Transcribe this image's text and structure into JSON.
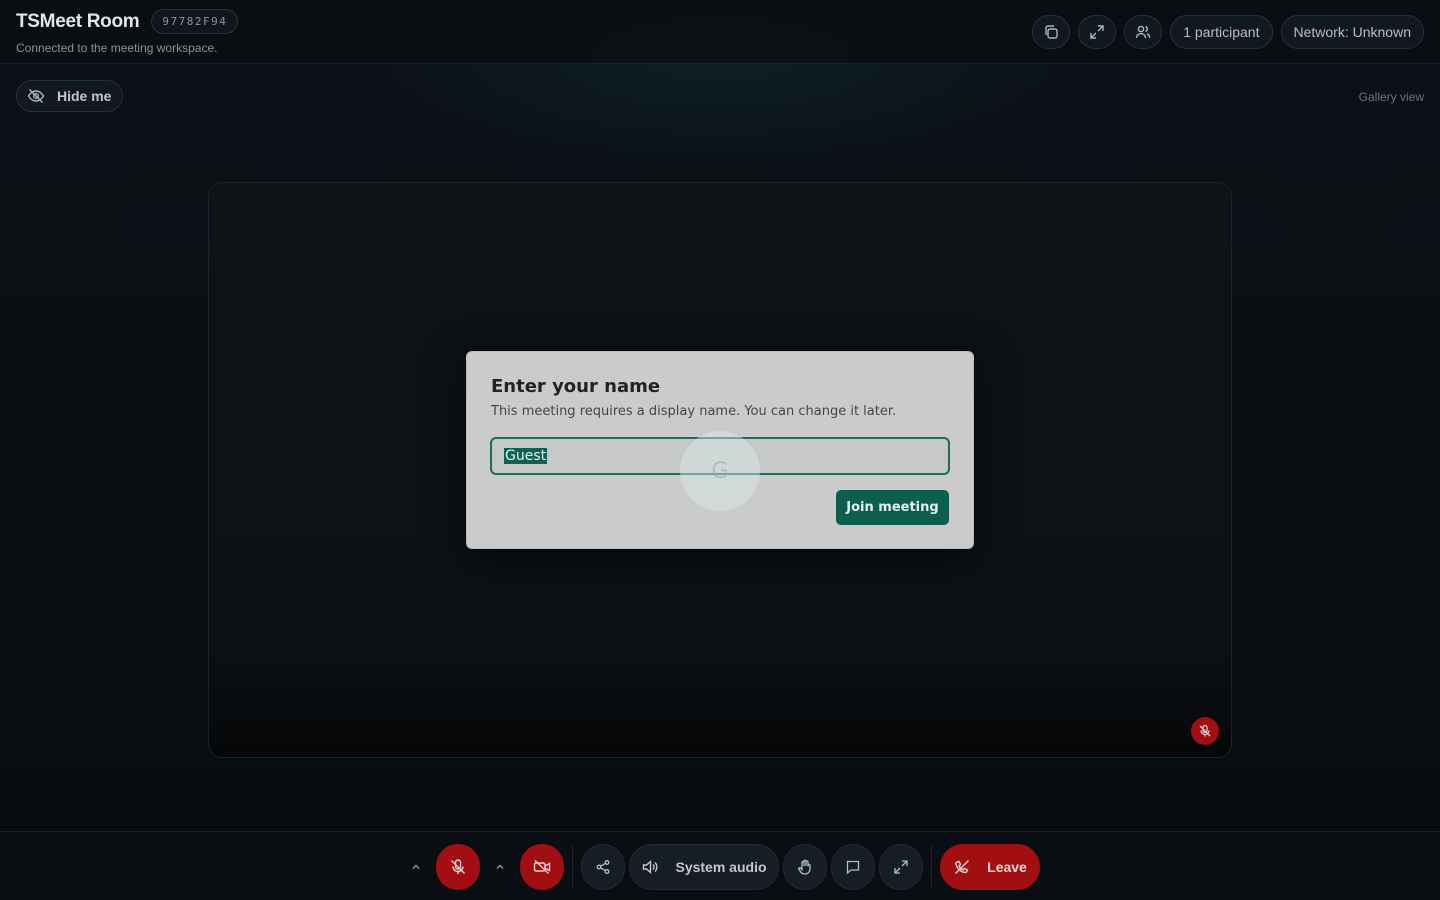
{
  "header": {
    "title": "TSMeet Room",
    "room_id": "97782F94",
    "subtitle": "Connected to the meeting workspace.",
    "participants_label": "1 participant",
    "network_label": "Network: Unknown",
    "icons": [
      "copy-icon",
      "expand-icon",
      "users-icon"
    ]
  },
  "subbar": {
    "hide_me_label": "Hide me",
    "gallery_view_label": "Gallery view"
  },
  "modal": {
    "title": "Enter your name",
    "description": "This meeting requires a display name. You can change it later.",
    "name_value": "Guest",
    "join_label": "Join meeting",
    "accent": "#0e5e50"
  },
  "toolbar": {
    "system_audio_label": "System audio",
    "leave_label": "Leave",
    "danger_color": "#a10f12"
  }
}
